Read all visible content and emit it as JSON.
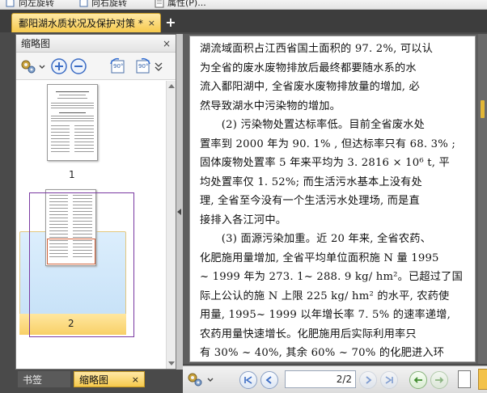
{
  "toolbar": {
    "rotate_left_label": "向左旋转",
    "rotate_right_label": "向右旋转",
    "properties_label": "属性(P)..."
  },
  "document_tab": {
    "title": "鄱阳湖水质状况及保护对策 *",
    "close": "×",
    "new_tab": "+"
  },
  "left_panel": {
    "title": "缩略图",
    "close": "×",
    "rotate_ccw_label": "90°",
    "rotate_cw_label": "90°",
    "thumbnails": [
      {
        "page_label": "1"
      },
      {
        "page_label": "2"
      }
    ],
    "selected_page": 2
  },
  "bottom_tabs": {
    "bookmarks_label": "书签",
    "thumbnails_label": "缩略图",
    "close": "×"
  },
  "document": {
    "lines": [
      "湖流域面积占江西省国土面积的 97. 2%, 可以认",
      "为全省的废水废物排放后最终都要随水系的水",
      "流入鄱阳湖中, 全省废水废物排放量的增加, 必",
      "然导致湖水中污染物的增加。",
      "　　(2) 污染物处置达标率低。目前全省废水处",
      "置率到 2000 年为 90. 1% , 但达标率只有 68. 3% ;",
      "固体废物处置率 5 年来平均为 3. 2816 × 10⁶ t, 平",
      "均处置率仅 1. 52%; 而生活污水基本上没有处",
      "理, 全省至今没有一个生活污水处理场, 而是直",
      "接排入各江河中。",
      "　　(3) 面源污染加重。近 20 年来, 全省农药、",
      "化肥施用量增加, 全省平均单位面积施 N 量 1995",
      "~ 1999 年为 273. 1~ 288. 9 kg/ hm²。已超过了国",
      "际上公认的施 N 上限 225 kg/ hm² 的水平, 农药使",
      "用量, 1995~ 1999 以年增长率 7. 5% 的速率递增,",
      "农药用量快速增长。化肥施用后实际利用率只",
      "有 30% ~ 40%, 其余 60% ~ 70% 的化肥进入环"
    ]
  },
  "navigation": {
    "page_indicator": "2/2"
  }
}
